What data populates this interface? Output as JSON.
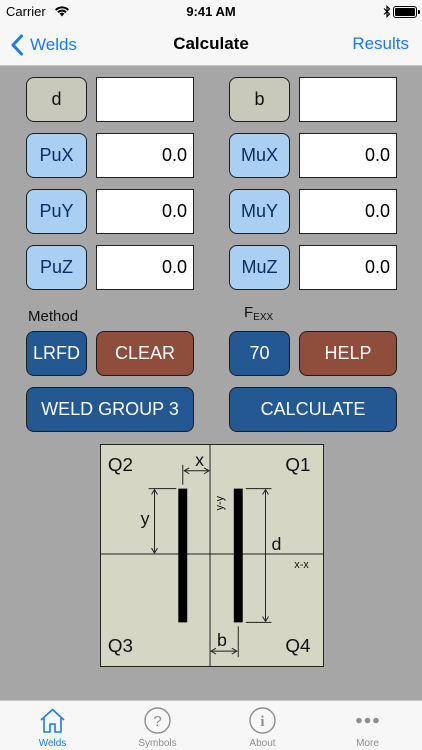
{
  "status": {
    "carrier": "Carrier",
    "time": "9:41 AM"
  },
  "nav": {
    "back_label": "Welds",
    "title": "Calculate",
    "right_label": "Results"
  },
  "inputs": {
    "d": {
      "label": "d",
      "value": ""
    },
    "b": {
      "label": "b",
      "value": ""
    },
    "pux": {
      "label": "PuX",
      "value": "0.0"
    },
    "mux": {
      "label": "MuX",
      "value": "0.0"
    },
    "puy": {
      "label": "PuY",
      "value": "0.0"
    },
    "muy": {
      "label": "MuY",
      "value": "0.0"
    },
    "puz": {
      "label": "PuZ",
      "value": "0.0"
    },
    "muz": {
      "label": "MuZ",
      "value": "0.0"
    }
  },
  "method": {
    "label": "Method",
    "value": "LRFD"
  },
  "fexx": {
    "label_main": "F",
    "label_sub": "EXX",
    "value": "70"
  },
  "buttons": {
    "clear": "CLEAR",
    "help": "HELP",
    "weld_group": "WELD GROUP 3",
    "calculate": "CALCULATE"
  },
  "diagram": {
    "q1": "Q1",
    "q2": "Q2",
    "q3": "Q3",
    "q4": "Q4",
    "x": "x",
    "y": "y",
    "d": "d",
    "b": "b",
    "xx": "x-x",
    "yy": "y-y"
  },
  "tabs": [
    {
      "label": "Welds",
      "icon": "home-icon",
      "active": true
    },
    {
      "label": "Symbols",
      "icon": "question-icon",
      "active": false
    },
    {
      "label": "About",
      "icon": "info-icon",
      "active": false
    },
    {
      "label": "More",
      "icon": "more-icon",
      "active": false
    }
  ],
  "colors": {
    "accent": "#1a7bf0",
    "blue_button": "#235892",
    "light_blue_button": "#a9cff2",
    "brown_button": "#8f4e3b",
    "gray_button": "#c9c9bb",
    "background": "#a6a6a6"
  }
}
